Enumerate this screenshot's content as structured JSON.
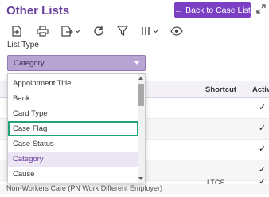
{
  "header": {
    "title": "Other Lists",
    "back_button_label": "Back to Case List",
    "back_arrow": "←"
  },
  "toolbar": {
    "icons": [
      "add-file-icon",
      "print-icon",
      "export-icon",
      "refresh-icon",
      "filter-icon",
      "columns-icon",
      "view-icon"
    ]
  },
  "list_type": {
    "label": "List Type",
    "selected": "Category"
  },
  "table": {
    "columns": [
      "Shortcut",
      "Active"
    ],
    "rows": [
      {
        "name": "",
        "shortcut": "",
        "active": "✓"
      },
      {
        "name": "",
        "shortcut": "",
        "active": "✓"
      },
      {
        "name": "",
        "shortcut": "",
        "active": "✓"
      },
      {
        "name": "",
        "shortcut": "",
        "active": "✓"
      },
      {
        "name": "",
        "shortcut": "LTCS",
        "active": "✓"
      },
      {
        "name": "Non-Workers Care (PN Work Different Employer)",
        "shortcut": "",
        "active": ""
      }
    ]
  },
  "dropdown": {
    "options": [
      "Appointment Title",
      "Bank",
      "Card Type",
      "Case Flag",
      "Case Status",
      "Category",
      "Cause"
    ],
    "selected_index": 5,
    "highlighted_index": 3
  },
  "colors": {
    "accent": "#7b3fc4",
    "title": "#6a3f9c",
    "highlight_outline": "#1fa57c"
  }
}
